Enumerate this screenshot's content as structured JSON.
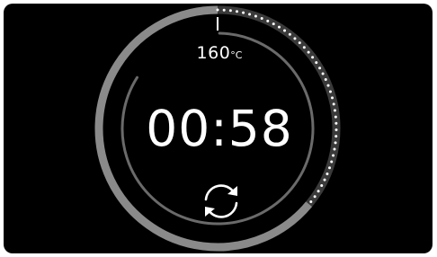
{
  "oven": {
    "temperature_value": "160",
    "temperature_unit": "°C",
    "timer": "00:58",
    "elapsed_fraction": 0.36
  },
  "icons": {
    "restart": "restart-arrows-icon"
  },
  "colors": {
    "background": "#000000",
    "ring_remaining": "#8a8a8a",
    "inner_arc": "#6a6a6a",
    "dots": "#ffffff",
    "text": "#ffffff"
  }
}
